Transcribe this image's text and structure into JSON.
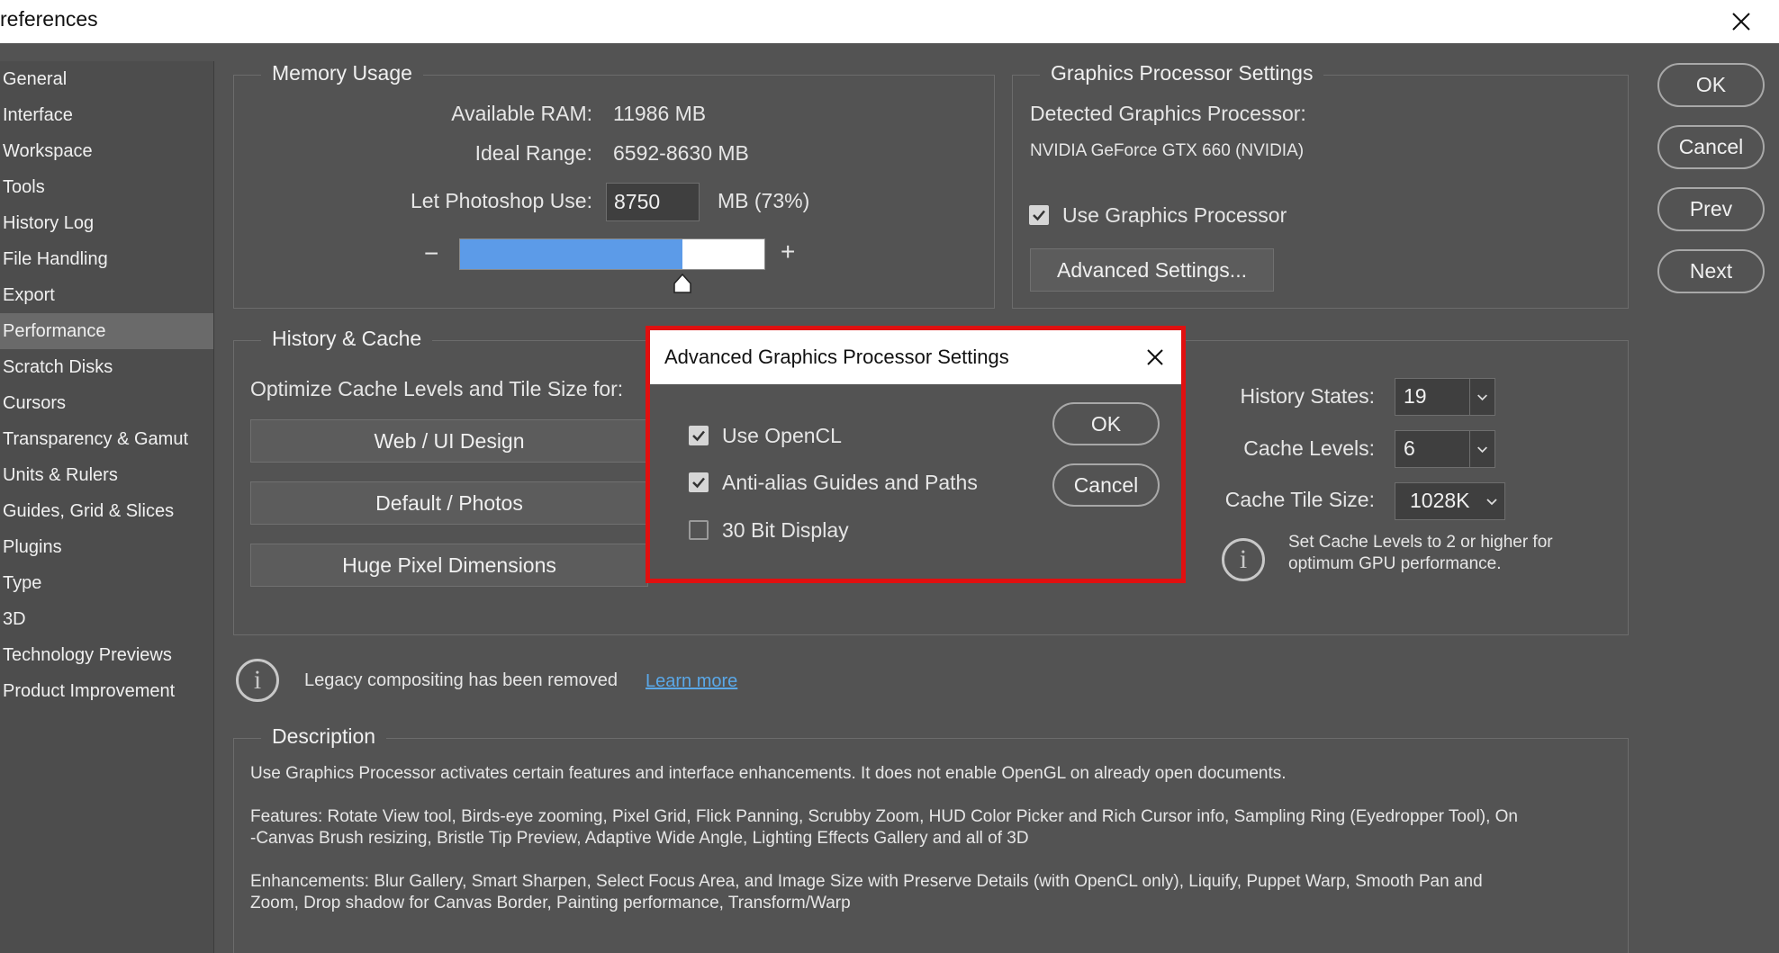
{
  "window": {
    "title": "references"
  },
  "sidebar": {
    "items": [
      {
        "label": "General"
      },
      {
        "label": "Interface"
      },
      {
        "label": "Workspace"
      },
      {
        "label": "Tools"
      },
      {
        "label": "History Log"
      },
      {
        "label": "File Handling"
      },
      {
        "label": "Export"
      },
      {
        "label": "Performance",
        "selected": true
      },
      {
        "label": "Scratch Disks"
      },
      {
        "label": "Cursors"
      },
      {
        "label": "Transparency & Gamut"
      },
      {
        "label": "Units & Rulers"
      },
      {
        "label": "Guides, Grid & Slices"
      },
      {
        "label": "Plugins"
      },
      {
        "label": "Type"
      },
      {
        "label": "3D"
      },
      {
        "label": "Technology Previews"
      },
      {
        "label": "Product Improvement"
      }
    ]
  },
  "memory": {
    "title": "Memory Usage",
    "available_label": "Available RAM:",
    "available_value": "11986 MB",
    "ideal_label": "Ideal Range:",
    "ideal_value": "6592-8630 MB",
    "let_use_label": "Let Photoshop Use:",
    "let_use_value": "8750",
    "let_use_suffix": "MB (73%)",
    "slider_fraction": 0.73,
    "minus": "−",
    "plus": "+"
  },
  "gpu": {
    "title": "Graphics Processor Settings",
    "detected_label": "Detected Graphics Processor:",
    "detected_value": "NVIDIA GeForce GTX 660 (NVIDIA)",
    "use_gpu_label": "Use Graphics Processor",
    "use_gpu_checked": true,
    "advanced_button": "Advanced Settings..."
  },
  "buttons": {
    "ok": "OK",
    "cancel": "Cancel",
    "prev": "Prev",
    "next": "Next"
  },
  "history_cache": {
    "title": "History & Cache",
    "optimize_label": "Optimize Cache Levels and Tile Size for:",
    "presets": [
      "Web / UI Design",
      "Default / Photos",
      "Huge Pixel Dimensions"
    ],
    "history_states_label": "History States:",
    "history_states_value": "19",
    "cache_levels_label": "Cache Levels:",
    "cache_levels_value": "6",
    "tile_size_label": "Cache Tile Size:",
    "tile_size_value": "1028K",
    "info_text_1": "Set Cache Levels to 2 or higher for",
    "info_text_2": "optimum GPU performance."
  },
  "legacy": {
    "text": "Legacy compositing has been removed",
    "link": "Learn more",
    "link_color": "#5aa8e8"
  },
  "description": {
    "title": "Description",
    "p1": "Use Graphics Processor activates certain features and interface enhancements. It does not enable OpenGL on already open documents.",
    "p2_line1": "Features: Rotate View tool, Birds-eye zooming, Pixel Grid, Flick Panning, Scrubby Zoom, HUD Color Picker and Rich Cursor info, Sampling Ring (Eyedropper Tool), On",
    "p2_line2": "-Canvas Brush resizing, Bristle Tip Preview, Adaptive Wide Angle, Lighting Effects Gallery and all of 3D",
    "p3_line1": "Enhancements: Blur Gallery, Smart Sharpen, Select Focus Area, and Image Size with Preserve Details (with OpenCL only), Liquify, Puppet Warp, Smooth Pan and",
    "p3_line2": "Zoom, Drop shadow for Canvas Border, Painting performance, Transform/Warp"
  },
  "dialog": {
    "title": "Advanced Graphics Processor Settings",
    "options": [
      {
        "label": "Use OpenCL",
        "checked": true
      },
      {
        "label": "Anti-alias Guides and Paths",
        "checked": true
      },
      {
        "label": "30 Bit Display",
        "checked": false
      }
    ],
    "ok": "OK",
    "cancel": "Cancel",
    "highlight_color": "#e01010"
  }
}
